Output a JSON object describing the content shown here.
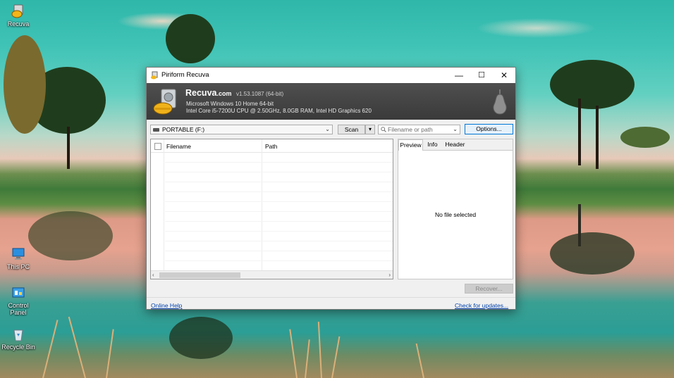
{
  "desktop": {
    "icons": [
      {
        "label": "Recuva"
      },
      {
        "label": "This PC"
      },
      {
        "label": "Control Panel"
      },
      {
        "label": "Recycle Bin"
      }
    ]
  },
  "window": {
    "title": "Piriform Recuva",
    "controls": {
      "minimize": "—",
      "maximize": "☐",
      "close": "✕"
    }
  },
  "banner": {
    "brand": "Recuva",
    "brand_suffix": ".com",
    "version": "v1.53.1087 (64-bit)",
    "os": "Microsoft Windows 10 Home 64-bit",
    "hardware": "Intel Core i5-7200U CPU @ 2.50GHz, 8.0GB RAM, Intel HD Graphics 620"
  },
  "toolbar": {
    "drive": "PORTABLE (F:)",
    "scan_label": "Scan",
    "search_placeholder": "Filename or path",
    "options_label": "Options..."
  },
  "filelist": {
    "columns": [
      "Filename",
      "Path"
    ],
    "rows": []
  },
  "preview": {
    "tabs": [
      "Preview",
      "Info",
      "Header"
    ],
    "active_tab": "Preview",
    "empty_message": "No file selected"
  },
  "actions": {
    "recover_label": "Recover..."
  },
  "footer": {
    "online_help": "Online Help",
    "check_updates": "Check for updates..."
  },
  "colors": {
    "banner": "#3f3f3f",
    "accent_border": "#0078d7",
    "link": "#0645ad"
  }
}
